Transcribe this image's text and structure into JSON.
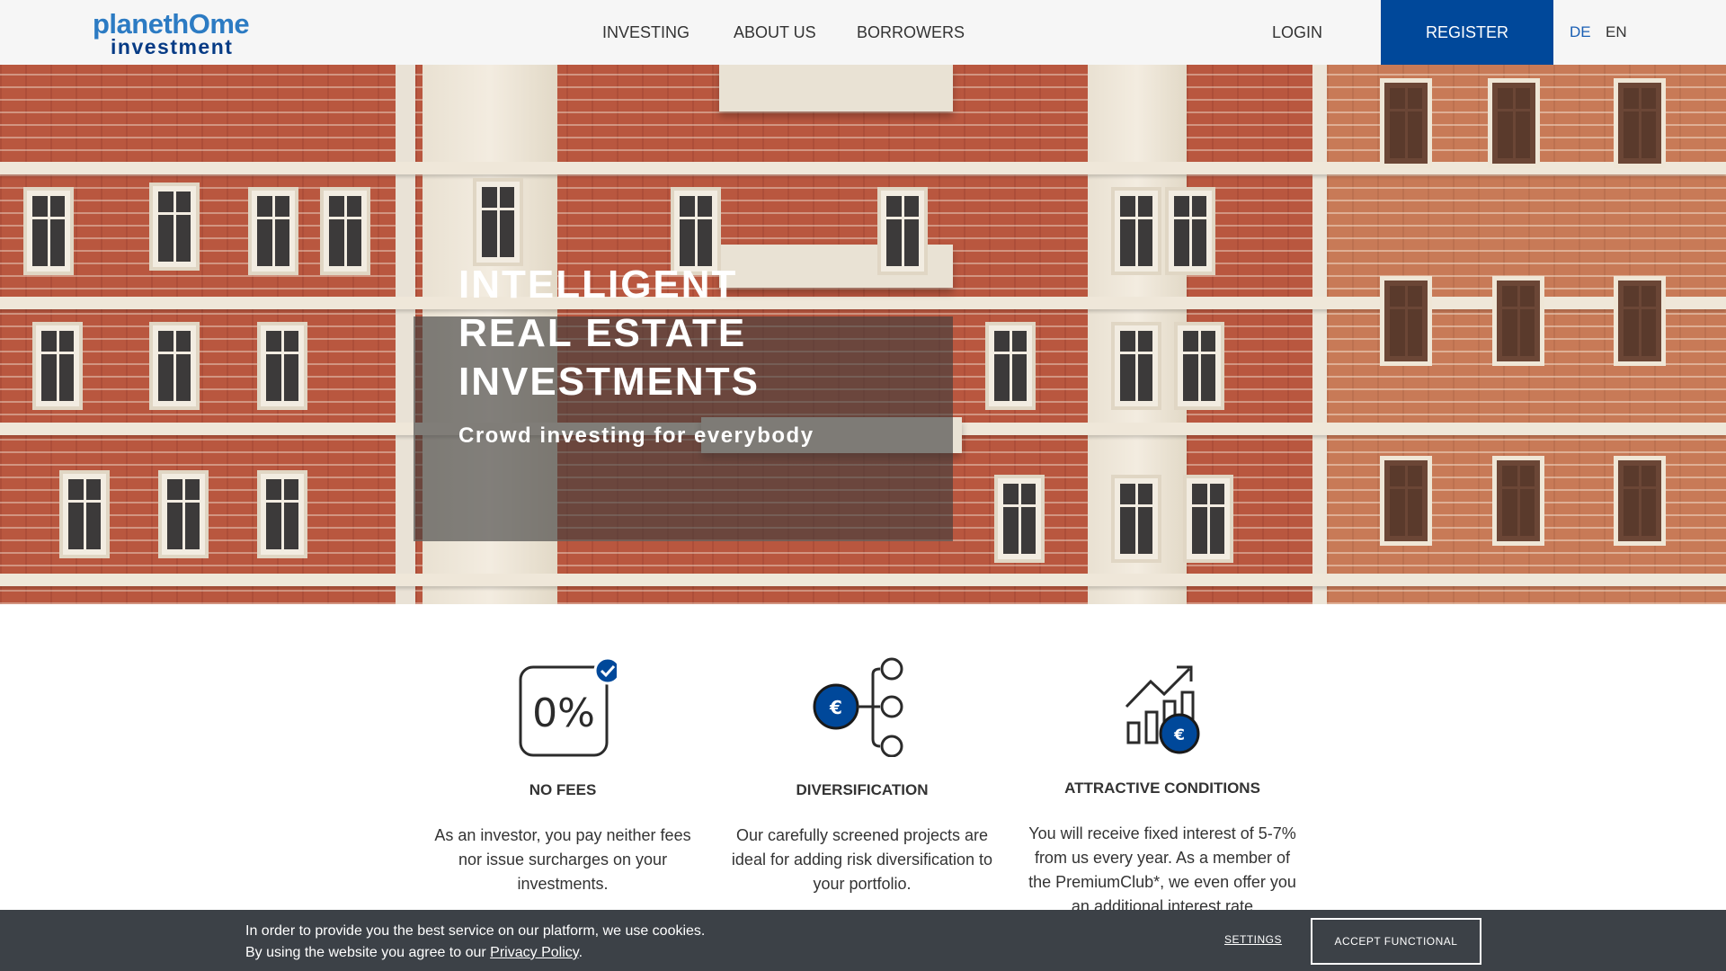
{
  "header": {
    "logo": {
      "line1": "planethOme",
      "line2": "investment"
    },
    "nav": [
      {
        "label": "INVESTING"
      },
      {
        "label": "ABOUT US"
      },
      {
        "label": "BORROWERS"
      }
    ],
    "login_label": "LOGIN",
    "register_label": "REGISTER",
    "languages": [
      {
        "label": "DE",
        "active": true
      },
      {
        "label": "EN",
        "active": false
      }
    ]
  },
  "hero": {
    "title": "INTELLIGENT\nREAL ESTATE\nINVESTMENTS",
    "subtitle": "Crowd investing for everybody"
  },
  "features": [
    {
      "icon": "zero-percent-icon",
      "title": "NO FEES",
      "text": "As an investor, you pay neither fees nor issue surcharges on your investments."
    },
    {
      "icon": "diversification-icon",
      "title": "DIVERSIFICATION",
      "text": "Our carefully screened projects are ideal for adding risk diversification to your portfolio."
    },
    {
      "icon": "growth-chart-icon",
      "title": "ATTRACTIVE CONDITIONS",
      "text": "You will receive fixed interest of 5-7% from us every year. As a member of the PremiumClub*, we even offer you an additional interest rate"
    }
  ],
  "cookie_bar": {
    "line1": "In order to provide you the best service on our platform, we use cookies.",
    "line2_prefix": "By using the website you agree to our ",
    "privacy_link": "Privacy Policy",
    "line2_suffix": ".",
    "settings_label": "SETTINGS",
    "accept_label": "ACCEPT FUNCTIONAL"
  },
  "colors": {
    "brand_blue": "#00489a",
    "logo_light_blue": "#2c7bc3",
    "cookie_bg": "#3c4147",
    "header_bg": "#f6f6f6"
  }
}
